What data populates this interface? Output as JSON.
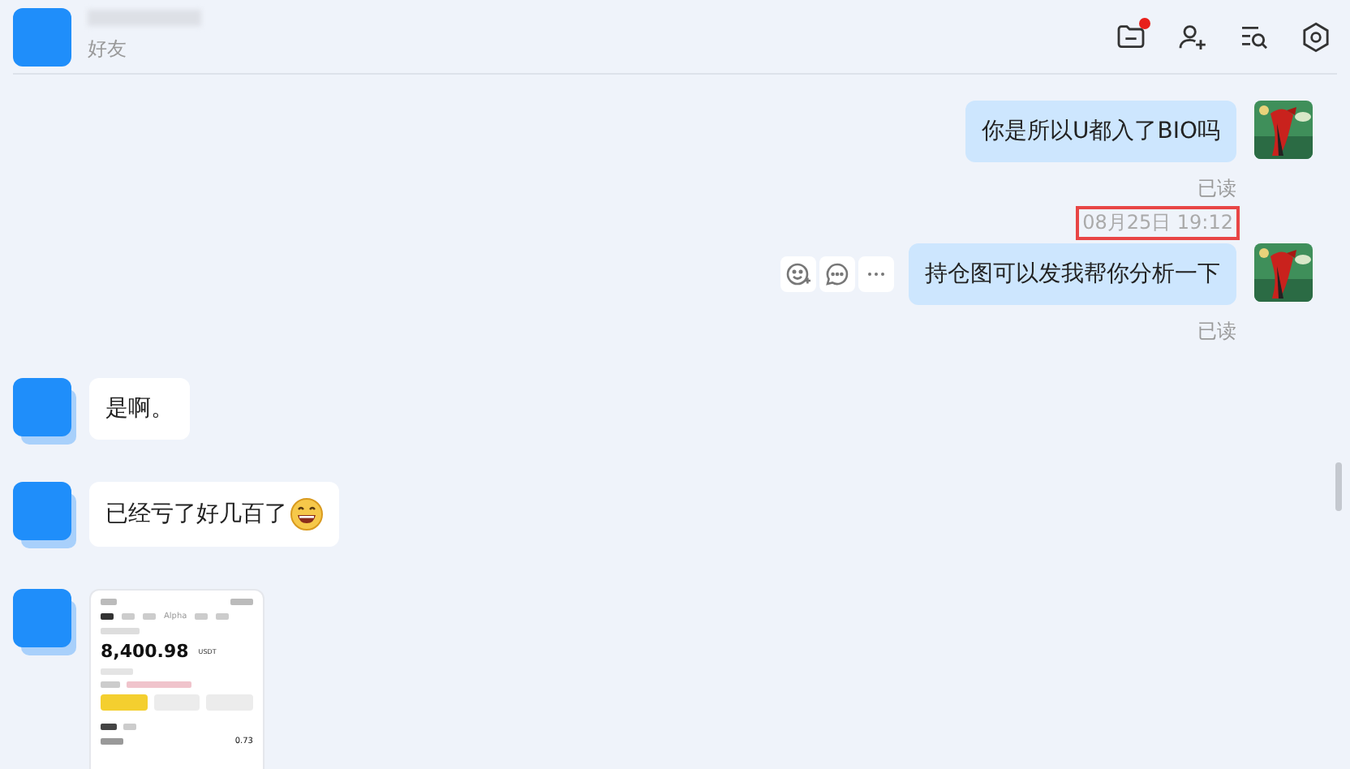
{
  "header": {
    "subtitle": "好友",
    "actions": [
      {
        "kind": "folder",
        "badge": true
      },
      {
        "kind": "add-user",
        "badge": false
      },
      {
        "kind": "search-list",
        "badge": false
      },
      {
        "kind": "settings",
        "badge": false
      }
    ]
  },
  "messages": [
    {
      "kind": "text",
      "mine": true,
      "text": "你是所以U都入了BIO吗",
      "status": "已读"
    },
    {
      "kind": "time",
      "text": "08月25日 19:12",
      "highlighted": true
    },
    {
      "kind": "text",
      "mine": true,
      "text": "持仓图可以发我帮你分析一下",
      "status": "已读",
      "hover_actions": true
    },
    {
      "kind": "text",
      "mine": false,
      "text": "是啊。"
    },
    {
      "kind": "text",
      "mine": false,
      "text": "已经亏了好几百了",
      "trailing_emoji": true
    },
    {
      "mine": false,
      "screenshot": {
        "tab": "Alpha",
        "balance": "8,400.98",
        "currency": "USDT",
        "asset_value": "0.73"
      }
    }
  ]
}
